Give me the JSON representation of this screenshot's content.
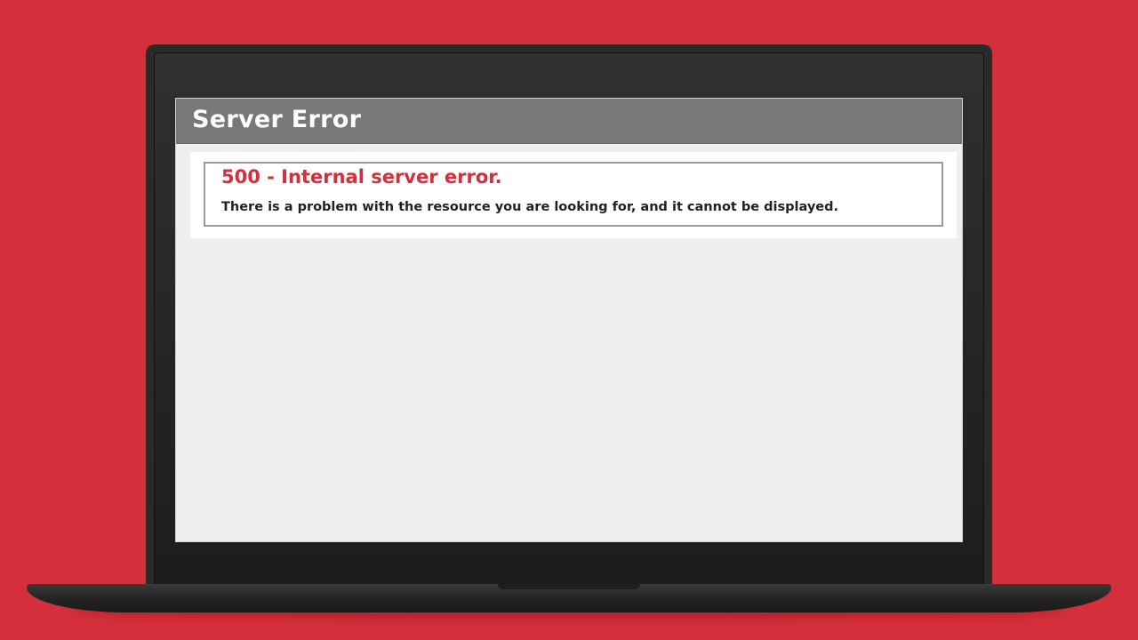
{
  "page": {
    "header_title": "Server Error",
    "error_heading": "500 - Internal server error.",
    "error_message": "There is a problem with the resource you are looking for, and it cannot be displayed."
  },
  "colors": {
    "background": "#d42f3a",
    "header_bar": "#787878",
    "error_heading": "#d42f3a",
    "screen": "#efefef"
  }
}
